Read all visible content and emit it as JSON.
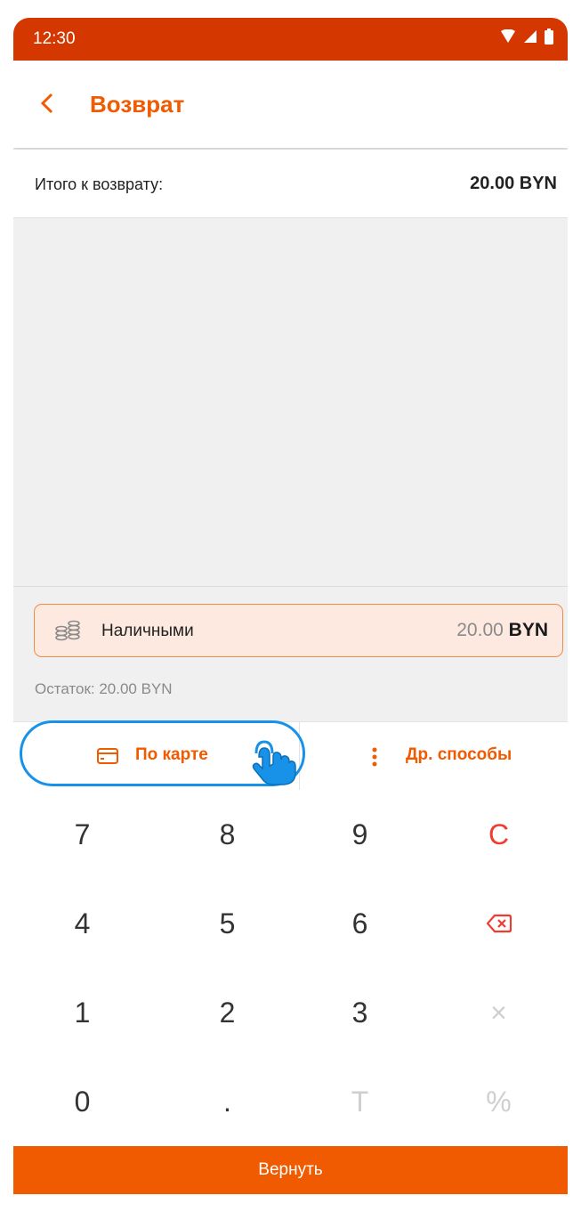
{
  "status_bar": {
    "time": "12:30"
  },
  "header": {
    "title": "Возврат"
  },
  "total": {
    "label": "Итого к возврату:",
    "value": "20.00 BYN"
  },
  "payment": {
    "method": "Наличными",
    "amount": "20.00",
    "currency": "BYN"
  },
  "remainder": "Остаток: 20.00 BYN",
  "methods": {
    "card_label": "По карте",
    "other_label": "Др. способы"
  },
  "keypad": {
    "k7": "7",
    "k8": "8",
    "k9": "9",
    "clear": "C",
    "k4": "4",
    "k5": "5",
    "k6": "6",
    "k1": "1",
    "k2": "2",
    "k3": "3",
    "multiply": "×",
    "k0": "0",
    "dot": ".",
    "t": "T",
    "percent": "%"
  },
  "submit_label": "Вернуть",
  "colors": {
    "accent": "#f05a00",
    "status_bar": "#d43700",
    "highlight": "#1892e8",
    "clear_key": "#f23b30"
  }
}
